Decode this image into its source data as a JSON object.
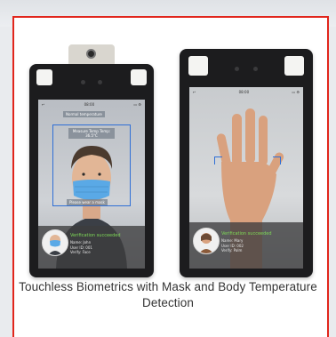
{
  "device_left": {
    "status_time": "08:00",
    "top_tag": "Normal temperature",
    "face_box_text": "Measure Temp Temp: 36.5°C",
    "bottom_tag": "Please wear a mask",
    "result_title": "Verification succeeded",
    "result_lines": [
      "Name: John",
      "User ID: 001",
      "Verify: Face"
    ]
  },
  "device_right": {
    "status_time": "08:00",
    "result_title": "Verification succeeded",
    "result_lines": [
      "Name: Mary",
      "User ID: 002",
      "Verify: Palm"
    ]
  },
  "caption": "Touchless Biometrics with Mask and Body Temperature Detection",
  "colors": {
    "frame_border": "#e1261c",
    "device_body": "#1c1c1e",
    "face_box": "#2f6fd6",
    "success": "#7ed957"
  }
}
